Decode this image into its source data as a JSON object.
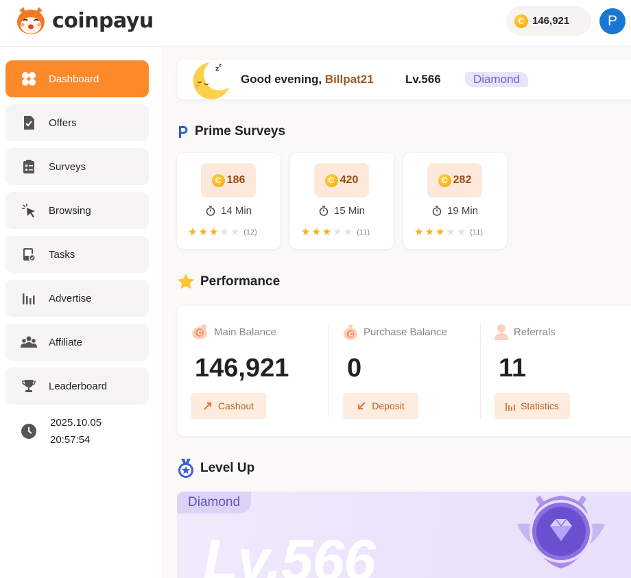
{
  "header": {
    "logo_text": "coinpayu",
    "balance": "146,921",
    "coin_symbol": "C",
    "avatar_initial": "P",
    "avatar_color": "#1976d2"
  },
  "sidebar": {
    "items": [
      {
        "label": "Dashboard",
        "icon": "dashboard-icon",
        "active": true
      },
      {
        "label": "Offers",
        "icon": "offers-icon"
      },
      {
        "label": "Surveys",
        "icon": "surveys-icon"
      },
      {
        "label": "Browsing",
        "icon": "cursor-icon"
      },
      {
        "label": "Tasks",
        "icon": "tasks-icon"
      },
      {
        "label": "Advertise",
        "icon": "bar-chart-icon"
      },
      {
        "label": "Affiliate",
        "icon": "people-icon"
      },
      {
        "label": "Leaderboard",
        "icon": "trophy-icon"
      }
    ],
    "date": "2025.10.05",
    "time": "20:57:54",
    "accent_color": "#fc8a2a"
  },
  "greeting": {
    "text": "Good evening,",
    "username": "Billpat21",
    "level": "Lv.566",
    "tier": "Diamond"
  },
  "prime_surveys": {
    "title": "Prime Surveys",
    "cards": [
      {
        "reward": "186",
        "time": "14 Min",
        "rating": 3,
        "count": "(12)"
      },
      {
        "reward": "420",
        "time": "15 Min",
        "rating": 3,
        "count": "(11)"
      },
      {
        "reward": "282",
        "time": "19 Min",
        "rating": 3,
        "count": "(11)"
      }
    ]
  },
  "performance": {
    "title": "Performance",
    "columns": [
      {
        "label": "Main Balance",
        "value": "146,921",
        "button": "Cashout",
        "icon": "piggy-coin-icon",
        "button_icon": "cashout-arrow-icon"
      },
      {
        "label": "Purchase Balance",
        "value": "0",
        "button": "Deposit",
        "icon": "coin-bag-icon",
        "button_icon": "deposit-arrow-icon"
      },
      {
        "label": "Referrals",
        "value": "11",
        "button": "Statistics",
        "icon": "person-icon",
        "button_icon": "stats-bars-icon"
      }
    ]
  },
  "level_up": {
    "title": "Level Up",
    "tier": "Diamond",
    "level": "Lv.566"
  }
}
